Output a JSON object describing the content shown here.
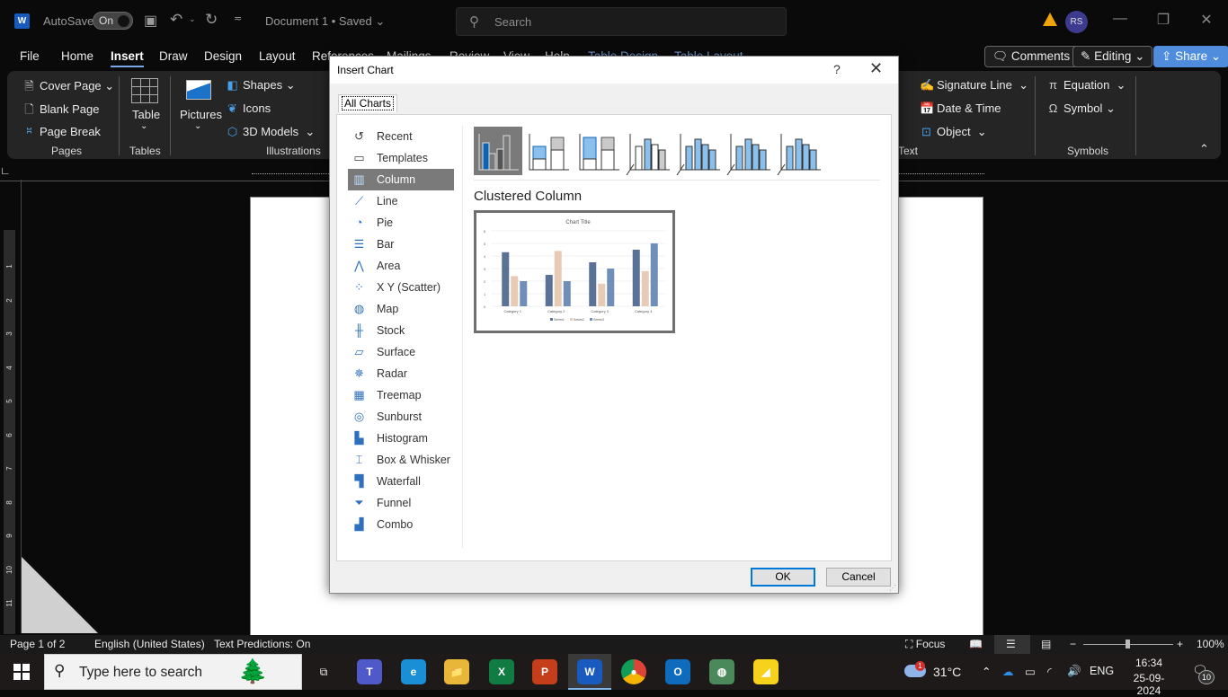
{
  "titlebar": {
    "app_icon": "word-icon",
    "autosave_label": "AutoSave",
    "autosave_state": "On",
    "doc_title": "Document 1 • Saved",
    "search_placeholder": "Search",
    "user_initials": "RS"
  },
  "menu": {
    "tabs": [
      "File",
      "Home",
      "Insert",
      "Draw",
      "Design",
      "Layout",
      "References",
      "Mailings",
      "Review",
      "View",
      "Help",
      "Table Design",
      "Table Layout"
    ],
    "active_tab": "Insert",
    "comments": "Comments",
    "editing": "Editing",
    "share": "Share"
  },
  "ribbon": {
    "pages": {
      "label": "Pages",
      "items": [
        "Cover Page",
        "Blank Page",
        "Page Break"
      ]
    },
    "tables": {
      "label": "Tables",
      "table": "Table"
    },
    "illustrations": {
      "label": "Illustrations",
      "pictures": "Pictures",
      "items": [
        "Shapes",
        "Icons",
        "3D Models"
      ]
    },
    "text": {
      "label": "Text",
      "items": [
        "Signature Line",
        "Date & Time",
        "Object"
      ]
    },
    "symbols": {
      "label": "Symbols",
      "items": [
        "Equation",
        "Symbol"
      ]
    }
  },
  "vruler": [
    "1",
    "2",
    "3",
    "4",
    "5",
    "6",
    "7",
    "8",
    "9",
    "10",
    "11"
  ],
  "dialog": {
    "title": "Insert Chart",
    "help": "?",
    "tab": "All Charts",
    "categories": [
      {
        "label": "Recent",
        "icon": "recent-icon",
        "glyph": "↺"
      },
      {
        "label": "Templates",
        "icon": "folder-icon",
        "glyph": "▭"
      },
      {
        "label": "Column",
        "icon": "column-chart-icon",
        "glyph": "▥"
      },
      {
        "label": "Line",
        "icon": "line-chart-icon",
        "glyph": "⟋"
      },
      {
        "label": "Pie",
        "icon": "pie-chart-icon",
        "glyph": "◔"
      },
      {
        "label": "Bar",
        "icon": "bar-chart-icon",
        "glyph": "☰"
      },
      {
        "label": "Area",
        "icon": "area-chart-icon",
        "glyph": "⋀"
      },
      {
        "label": "X Y (Scatter)",
        "icon": "scatter-chart-icon",
        "glyph": "⁘"
      },
      {
        "label": "Map",
        "icon": "map-chart-icon",
        "glyph": "◍"
      },
      {
        "label": "Stock",
        "icon": "stock-chart-icon",
        "glyph": "╫"
      },
      {
        "label": "Surface",
        "icon": "surface-chart-icon",
        "glyph": "▱"
      },
      {
        "label": "Radar",
        "icon": "radar-chart-icon",
        "glyph": "✵"
      },
      {
        "label": "Treemap",
        "icon": "treemap-chart-icon",
        "glyph": "▦"
      },
      {
        "label": "Sunburst",
        "icon": "sunburst-chart-icon",
        "glyph": "◎"
      },
      {
        "label": "Histogram",
        "icon": "histogram-chart-icon",
        "glyph": "▙"
      },
      {
        "label": "Box & Whisker",
        "icon": "box-whisker-icon",
        "glyph": "⌶"
      },
      {
        "label": "Waterfall",
        "icon": "waterfall-chart-icon",
        "glyph": "▜"
      },
      {
        "label": "Funnel",
        "icon": "funnel-chart-icon",
        "glyph": "⏷"
      },
      {
        "label": "Combo",
        "icon": "combo-chart-icon",
        "glyph": "▟"
      }
    ],
    "selected_category": "Column",
    "subtypes": [
      "Clustered Column",
      "Stacked Column",
      "100% Stacked Column",
      "3-D Clustered Column",
      "3-D Stacked Column",
      "3-D 100% Stacked Column",
      "3-D Column"
    ],
    "selected_subtype": "Clustered Column",
    "ok": "OK",
    "cancel": "Cancel"
  },
  "chart_data": {
    "type": "bar",
    "title": "Chart Title",
    "categories": [
      "Category 1",
      "Category 2",
      "Category 3",
      "Category 4"
    ],
    "series": [
      {
        "name": "Series1",
        "values": [
          4.3,
          2.5,
          3.5,
          4.5
        ],
        "color": "#5a7296"
      },
      {
        "name": "Series2",
        "values": [
          2.4,
          4.4,
          1.8,
          2.8
        ],
        "color": "#e8cbb5"
      },
      {
        "name": "Series3",
        "values": [
          2,
          2,
          3,
          5
        ],
        "color": "#6f8fb8"
      }
    ],
    "ylim": [
      0,
      6
    ],
    "yticks": [
      "0",
      "1",
      "2",
      "3",
      "4",
      "5",
      "6"
    ],
    "grid": true,
    "legend": "bottom"
  },
  "statusbar": {
    "page": "Page 1 of 2",
    "language": "English (United States)",
    "predictions": "Text Predictions: On",
    "focus": "Focus",
    "zoom": "100%",
    "zoom_fraction": 0.5
  },
  "taskbar": {
    "search_placeholder": "Type here to search",
    "apps": [
      {
        "name": "task-view",
        "label": "⧉",
        "color": "transparent"
      },
      {
        "name": "teams",
        "label": "T",
        "color": "#5059c9"
      },
      {
        "name": "edge",
        "label": "e",
        "color": "#1a8fd6"
      },
      {
        "name": "file-explorer",
        "label": "📁",
        "color": "#e8b739"
      },
      {
        "name": "excel",
        "label": "X",
        "color": "#107c41"
      },
      {
        "name": "powerpoint",
        "label": "P",
        "color": "#c43e1c"
      },
      {
        "name": "word",
        "label": "W",
        "color": "#185abd"
      },
      {
        "name": "chrome",
        "label": "●",
        "color": "#db4437"
      },
      {
        "name": "outlook",
        "label": "O",
        "color": "#0f6cbd"
      },
      {
        "name": "app-globe",
        "label": "◍",
        "color": "#4a8a5a"
      },
      {
        "name": "sticky-notes",
        "label": "◢",
        "color": "#f7d21c"
      }
    ],
    "weather": "31°C",
    "weather_badge": "1",
    "lang": "ENG",
    "time": "16:34",
    "date": "25-09-2024",
    "notifications": "10"
  }
}
